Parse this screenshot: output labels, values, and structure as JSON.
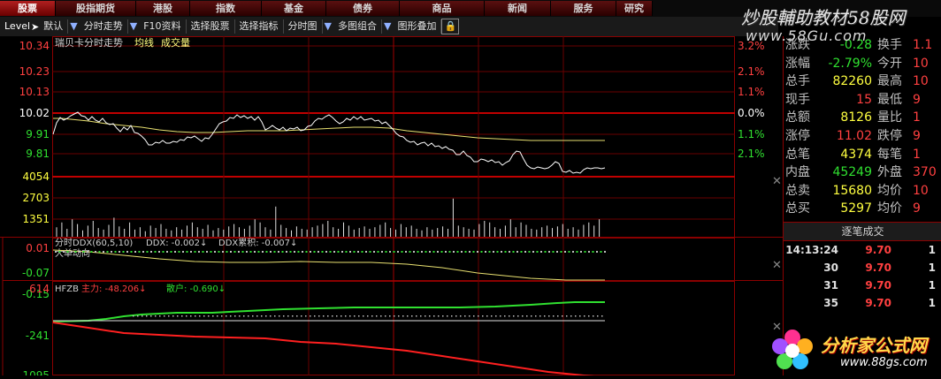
{
  "nav": [
    "股票",
    "股指期货",
    "港股",
    "指数",
    "基金",
    "债券",
    "商品",
    "新闻",
    "服务",
    "研究"
  ],
  "toolbar": {
    "level": "Level",
    "items": [
      "默认",
      "分时走势",
      "F10资料",
      "选择股票",
      "选择指标",
      "分时图",
      "多图组合",
      "图形叠加"
    ]
  },
  "main": {
    "title": "瑞贝卡分时走势",
    "avg_label": "均线",
    "vol_label": "成交量",
    "price_ticks": [
      "10.34",
      "10.23",
      "10.13",
      "10.02",
      "9.91",
      "9.81"
    ],
    "pct_ticks": [
      "3.2%",
      "2.1%",
      "1.1%",
      "0.0%",
      "1.1%",
      "2.1%"
    ],
    "vol_ticks": [
      "4054",
      "2703",
      "1351"
    ]
  },
  "ddx": {
    "header": "分时DDX(60,5,10)",
    "ddx_label": "DDX: -0.002↓",
    "ddx_cum": "DDX累积: -0.007↓",
    "sub": "大单动向",
    "ticks": [
      "0.01",
      "-0.07",
      "-0.15"
    ]
  },
  "hfzb": {
    "header": "HFZB",
    "main_label": "主力: -48.206↓",
    "retail_label": "散户: -0.690↓",
    "ticks": [
      "614",
      "-241",
      "-1095"
    ]
  },
  "quote": [
    {
      "l": "涨跌",
      "v": "-0.28",
      "vc": "#30e030",
      "l2": "换手",
      "v2": "1.1"
    },
    {
      "l": "涨幅",
      "v": "-2.79%",
      "vc": "#30e030",
      "l2": "今开",
      "v2": "10"
    },
    {
      "l": "总手",
      "v": "82260",
      "vc": "#ffff40",
      "l2": "最高",
      "v2": "10"
    },
    {
      "l": "现手",
      "v": "15",
      "vc": "#ff4040",
      "l2": "最低",
      "v2": "9"
    },
    {
      "l": "总额",
      "v": "8126",
      "vc": "#ffff40",
      "l2": "量比",
      "v2": "1"
    },
    {
      "l": "涨停",
      "v": "11.02",
      "vc": "#ff4040",
      "l2": "跌停",
      "v2": "9"
    },
    {
      "l": "总笔",
      "v": "4374",
      "vc": "#ffff40",
      "l2": "每笔",
      "v2": "1"
    },
    {
      "l": "内盘",
      "v": "45249",
      "vc": "#30e030",
      "l2": "外盘",
      "v2": "370"
    },
    {
      "l": "总卖",
      "v": "15680",
      "vc": "#ffff40",
      "l2": "均价",
      "v2": "10"
    },
    {
      "l": "总买",
      "v": "5297",
      "vc": "#ffff40",
      "l2": "均价",
      "v2": "9"
    }
  ],
  "trades": {
    "title": "逐笔成交",
    "rows": [
      {
        "t": "14:13:24",
        "p": "9.70",
        "q": "1"
      },
      {
        "t": "30",
        "p": "9.70",
        "q": "1"
      },
      {
        "t": "31",
        "p": "9.70",
        "q": "1"
      },
      {
        "t": "35",
        "p": "9.70",
        "q": "1"
      }
    ]
  },
  "watermark": {
    "top": "炒股輔助教材58股网",
    "top_url": "www.58Gu.com",
    "bottom": "分析家公式网",
    "bottom_url": "www.88gs.com"
  },
  "colors": {
    "up": "#ff4040",
    "down": "#30e030",
    "grid": "#8b0000",
    "price": "#ffffff",
    "avg": "#ffff80"
  }
}
